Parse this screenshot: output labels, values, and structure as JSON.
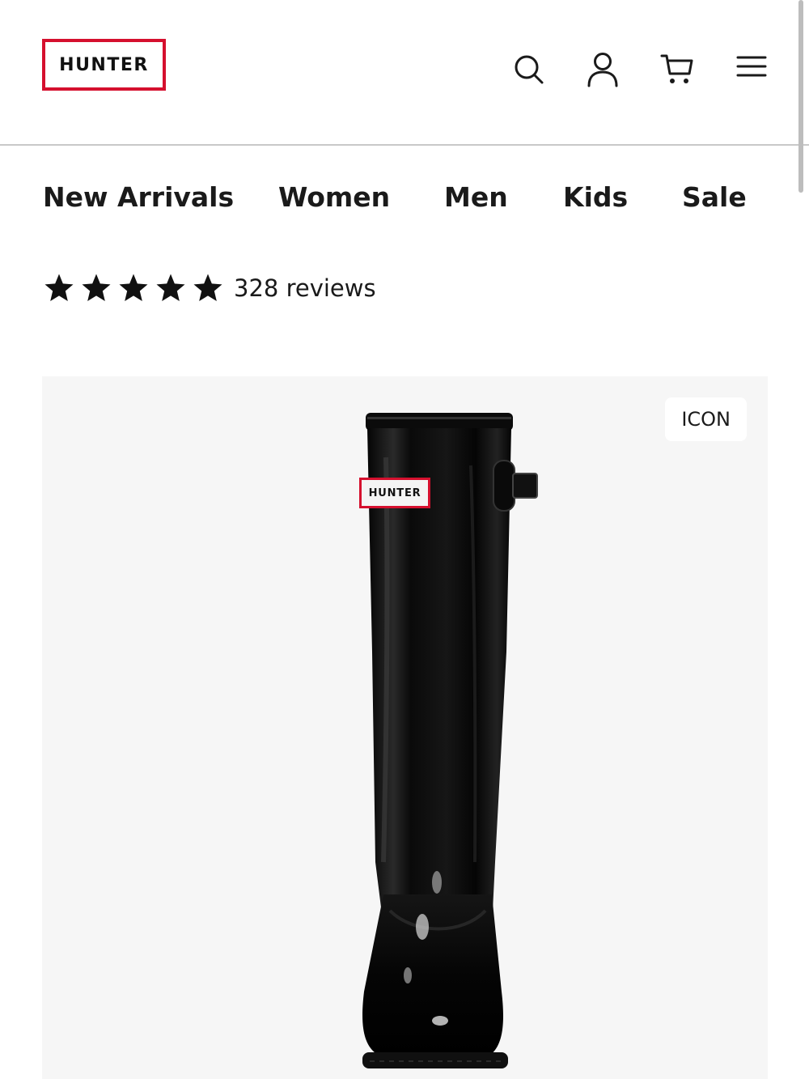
{
  "header": {
    "logo_text": "HUNTER",
    "icons": [
      "search-icon",
      "account-icon",
      "cart-icon",
      "menu-icon"
    ]
  },
  "nav": {
    "items": [
      {
        "label": "New Arrivals"
      },
      {
        "label": "Women"
      },
      {
        "label": "Men"
      },
      {
        "label": "Kids"
      },
      {
        "label": "Sale"
      }
    ]
  },
  "rating": {
    "stars": 5,
    "reviews_text": "328 reviews"
  },
  "product": {
    "badge": "ICON",
    "boot_brand_label": "HUNTER"
  },
  "colors": {
    "brand_red": "#d5102e",
    "text": "#111111",
    "image_bg": "#f6f6f6"
  }
}
